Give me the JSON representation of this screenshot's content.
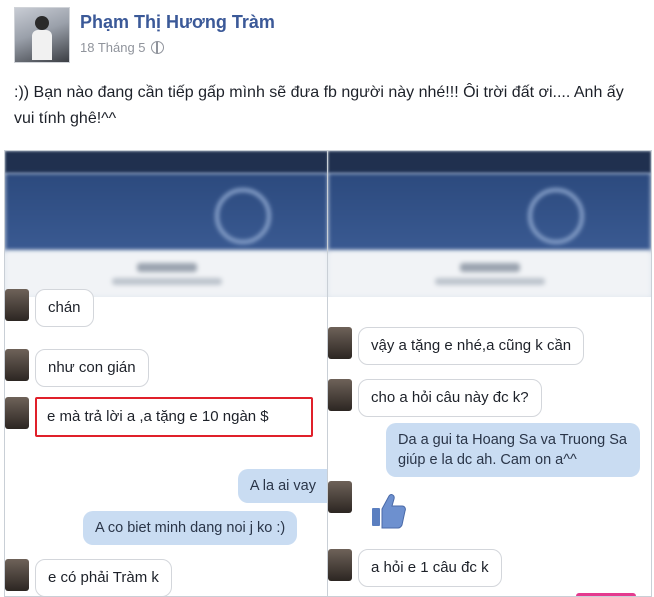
{
  "post": {
    "author": "Phạm Thị Hương Tràm",
    "date": "18 Tháng 5",
    "privacy_icon": "globe-icon",
    "text": ":)) Bạn nào đang cần tiếp gấp mình sẽ đưa fb người này nhé!!! Ôi trời đất ơi.... Anh ấy vui tính ghê!^^"
  },
  "left_screenshot": {
    "messages": [
      {
        "side": "in",
        "text": "chán"
      },
      {
        "side": "in",
        "text": "như con gián"
      },
      {
        "side": "in",
        "text": "e mà trả lời a ,a tặng e 10 ngàn $",
        "highlighted": true
      },
      {
        "side": "out",
        "text": "A la ai vay"
      },
      {
        "side": "out",
        "text": "A co biet minh dang noi j ko :)"
      },
      {
        "side": "in",
        "text": "e có phải Tràm k"
      }
    ]
  },
  "right_screenshot": {
    "messages": [
      {
        "side": "in",
        "text": "vậy a tặng e nhé,a cũng k cần"
      },
      {
        "side": "in",
        "text": "cho a hỏi câu này đc k?"
      },
      {
        "side": "out",
        "text": "Da a gui ta Hoang Sa va Truong Sa giúp e la dc ah. Cam on a^^"
      },
      {
        "side": "out",
        "type": "sticker",
        "icon": "thumbs-up-icon"
      },
      {
        "side": "in",
        "text": "a hỏi e 1 câu đc k"
      }
    ]
  },
  "colors": {
    "author_link": "#3b5998",
    "outgoing_bubble": "#c9dcf2",
    "highlight_box": "#e0202a",
    "messenger_header": "#2c4a7e"
  }
}
